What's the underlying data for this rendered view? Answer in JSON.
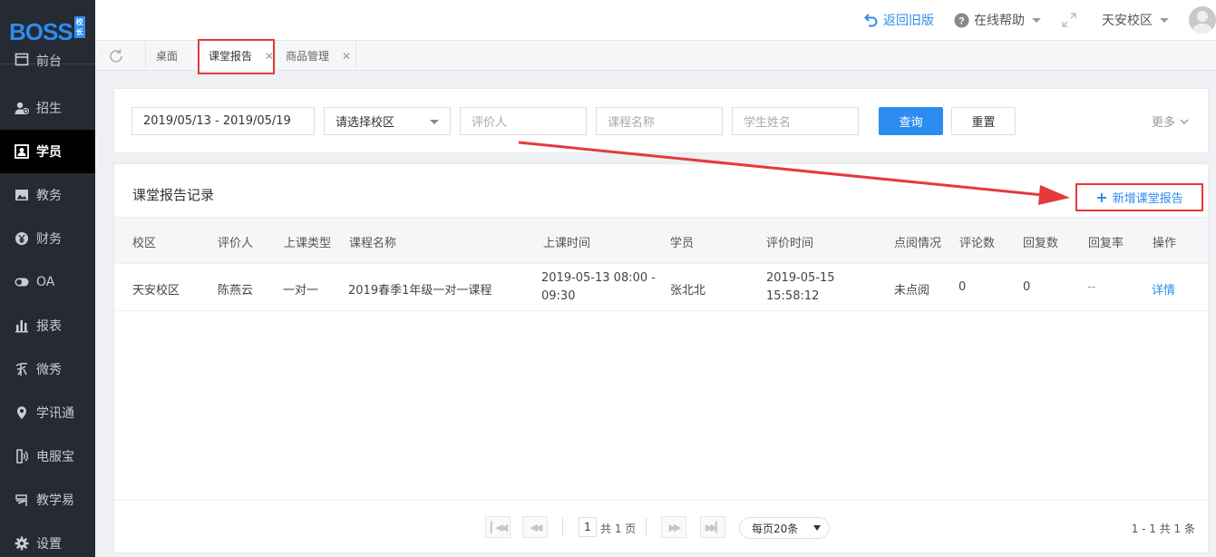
{
  "app": {
    "logo_text": "BOSS",
    "logo_badge": "校长"
  },
  "sidebar": {
    "items": [
      {
        "label": "前台",
        "icon": "calendar-icon"
      },
      {
        "label": "招生",
        "icon": "user-add-icon"
      },
      {
        "label": "学员",
        "icon": "student-icon",
        "active": true
      },
      {
        "label": "教务",
        "icon": "picture-icon"
      },
      {
        "label": "财务",
        "icon": "yen-icon"
      },
      {
        "label": "OA",
        "icon": "toggle-icon"
      },
      {
        "label": "报表",
        "icon": "bar-chart-icon"
      },
      {
        "label": "微秀",
        "icon": "weixiu-icon"
      },
      {
        "label": "学讯通",
        "icon": "location-icon"
      },
      {
        "label": "电服宝",
        "icon": "phone-icon"
      },
      {
        "label": "教学易",
        "icon": "book-icon"
      },
      {
        "label": "设置",
        "icon": "gear-icon"
      }
    ]
  },
  "topbar": {
    "back_label": "返回旧版",
    "help_label": "在线帮助",
    "campus_label": "天安校区"
  },
  "tabs": [
    {
      "label": "桌面"
    },
    {
      "label": "课堂报告"
    },
    {
      "label": "商品管理"
    }
  ],
  "filters": {
    "date_range": "2019/05/13 - 2019/05/19",
    "campus_select": "请选择校区",
    "evaluator_placeholder": "评价人",
    "course_placeholder": "课程名称",
    "student_placeholder": "学生姓名",
    "search_label": "查询",
    "reset_label": "重置",
    "more_label": "更多"
  },
  "records": {
    "title": "课堂报告记录",
    "add_label": "新增课堂报告",
    "columns": [
      "校区",
      "评价人",
      "上课类型",
      "课程名称",
      "上课时间",
      "学员",
      "评价时间",
      "点阅情况",
      "评论数",
      "回复数",
      "回复率",
      "操作"
    ],
    "rows": [
      {
        "campus": "天安校区",
        "evaluator": "陈燕云",
        "class_type": "一对一",
        "course": "2019春季1年级一对一课程",
        "class_time_1": "2019-05-13 08:00 -",
        "class_time_2": "09:30",
        "student": "张北北",
        "eval_time_1": "2019-05-15",
        "eval_time_2": "15:58:12",
        "read_status": "未点阅",
        "comments": "0",
        "replies": "0",
        "reply_rate": "--",
        "action": "详情"
      }
    ]
  },
  "pager": {
    "page": "1",
    "total_pages": "共 1 页",
    "page_size": "每页20条",
    "summary": "1 - 1   共 1 条"
  },
  "colors": {
    "accent": "#2d8cf0",
    "highlight": "#e5393b",
    "sidebar": "#252a33"
  }
}
